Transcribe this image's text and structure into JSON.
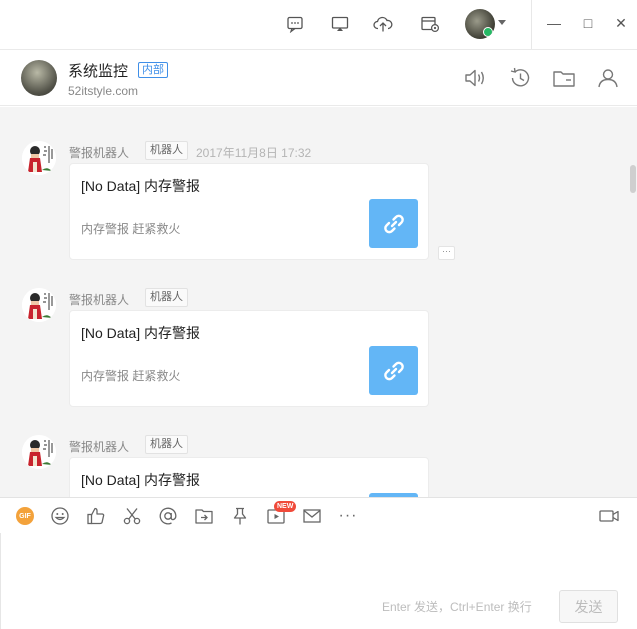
{
  "titlebar": {
    "icons": [
      "message-bubble-icon",
      "screen-share-icon",
      "cloud-upload-icon",
      "calendar-settings-icon"
    ],
    "window_controls": {
      "minimize": "—",
      "maximize": "□",
      "close": "✕"
    }
  },
  "header": {
    "group_name": "系统监控",
    "badge": "内部",
    "domain": "52itstyle.com"
  },
  "messages": [
    {
      "sender": "警报机器人",
      "tag": "机器人",
      "time": "2017年11月8日 17:32",
      "title": "[No Data] 内存警报",
      "desc": "内存警报 赶紧救火",
      "more": "···"
    },
    {
      "sender": "警报机器人",
      "tag": "机器人",
      "time": "",
      "title": "[No Data] 内存警报",
      "desc": "内存警报 赶紧救火"
    },
    {
      "sender": "警报机器人",
      "tag": "机器人",
      "time": "",
      "title": "[No Data] 内存警报",
      "desc": ""
    }
  ],
  "toolbar": {
    "gif_label": "GIF",
    "new_badge": "NEW",
    "more_label": "···"
  },
  "input": {
    "hint": "Enter 发送，Ctrl+Enter 换行",
    "send_label": "发送"
  },
  "colors": {
    "accent": "#3f8fe8",
    "link_tile": "#63b6f6",
    "gif": "#f3a23b",
    "new_badge": "#f04a3a",
    "message_bg": "#f4f4f4"
  }
}
